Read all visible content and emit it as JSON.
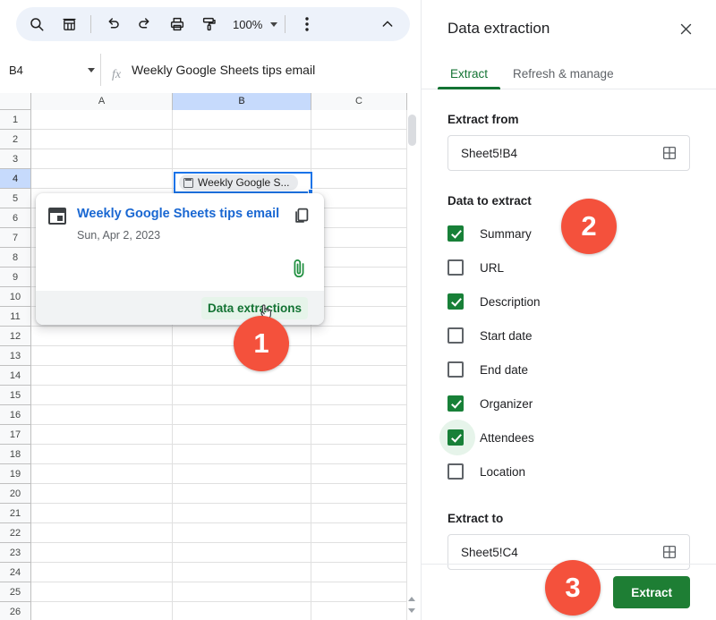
{
  "toolbar": {
    "icons": [
      {
        "name": "search-icon",
        "label": "Search"
      },
      {
        "name": "menus-icon",
        "label": "Menus"
      },
      {
        "name": "undo-icon",
        "label": "Undo"
      },
      {
        "name": "redo-icon",
        "label": "Redo"
      },
      {
        "name": "print-icon",
        "label": "Print"
      },
      {
        "name": "paint-format-icon",
        "label": "Paint format"
      }
    ],
    "zoom": "100%",
    "more_label": "More",
    "collapse_label": "Hide the menus"
  },
  "formula_bar": {
    "name_box_value": "B4",
    "fx_label": "fx",
    "formula_value": "Weekly Google Sheets tips email"
  },
  "grid": {
    "columns": [
      "A",
      "B",
      "C"
    ],
    "selected_column": "B",
    "selected_row": 4,
    "rows": [
      1,
      2,
      3,
      4,
      5,
      6,
      7,
      8,
      9,
      10,
      11,
      12,
      13,
      14,
      15,
      16,
      17,
      18,
      19,
      20,
      21,
      22,
      23,
      24,
      25,
      26
    ],
    "selected_cell": {
      "ref": "B4",
      "chip_text": "Weekly Google S...",
      "chip_icon": "calendar-icon"
    }
  },
  "popup": {
    "icon": "calendar-icon",
    "title": "Weekly Google Sheets tips email",
    "date": "Sun, Apr 2, 2023",
    "copy_icon": "copy-icon",
    "attachment_icon": "paperclip-icon",
    "link_label": "Data extractions"
  },
  "panel": {
    "title": "Data extraction",
    "close_label": "Close",
    "tabs": [
      {
        "label": "Extract",
        "active": true
      },
      {
        "label": "Refresh & manage",
        "active": false
      }
    ],
    "extract_from": {
      "label": "Extract from",
      "value": "Sheet5!B4",
      "picker_icon": "select-range-icon"
    },
    "data_to_extract": {
      "label": "Data to extract",
      "options": [
        {
          "label": "Summary",
          "checked": true,
          "hover": false
        },
        {
          "label": "URL",
          "checked": false,
          "hover": false
        },
        {
          "label": "Description",
          "checked": true,
          "hover": false
        },
        {
          "label": "Start date",
          "checked": false,
          "hover": false
        },
        {
          "label": "End date",
          "checked": false,
          "hover": false
        },
        {
          "label": "Organizer",
          "checked": true,
          "hover": false
        },
        {
          "label": "Attendees",
          "checked": true,
          "hover": true
        },
        {
          "label": "Location",
          "checked": false,
          "hover": false
        }
      ]
    },
    "extract_to": {
      "label": "Extract to",
      "value": "Sheet5!C4",
      "picker_icon": "select-range-icon"
    },
    "extract_button": "Extract"
  },
  "step_badges": [
    {
      "number": "1"
    },
    {
      "number": "2"
    },
    {
      "number": "3"
    }
  ],
  "colors": {
    "badge": "#F4513C",
    "accent_green": "#137333",
    "button_green": "#1E7E34",
    "selection_blue": "#1A73E8",
    "header_highlight": "#C6DAFC",
    "toolbar_bg": "#EDF2FA",
    "link_blue": "#1967D2"
  }
}
